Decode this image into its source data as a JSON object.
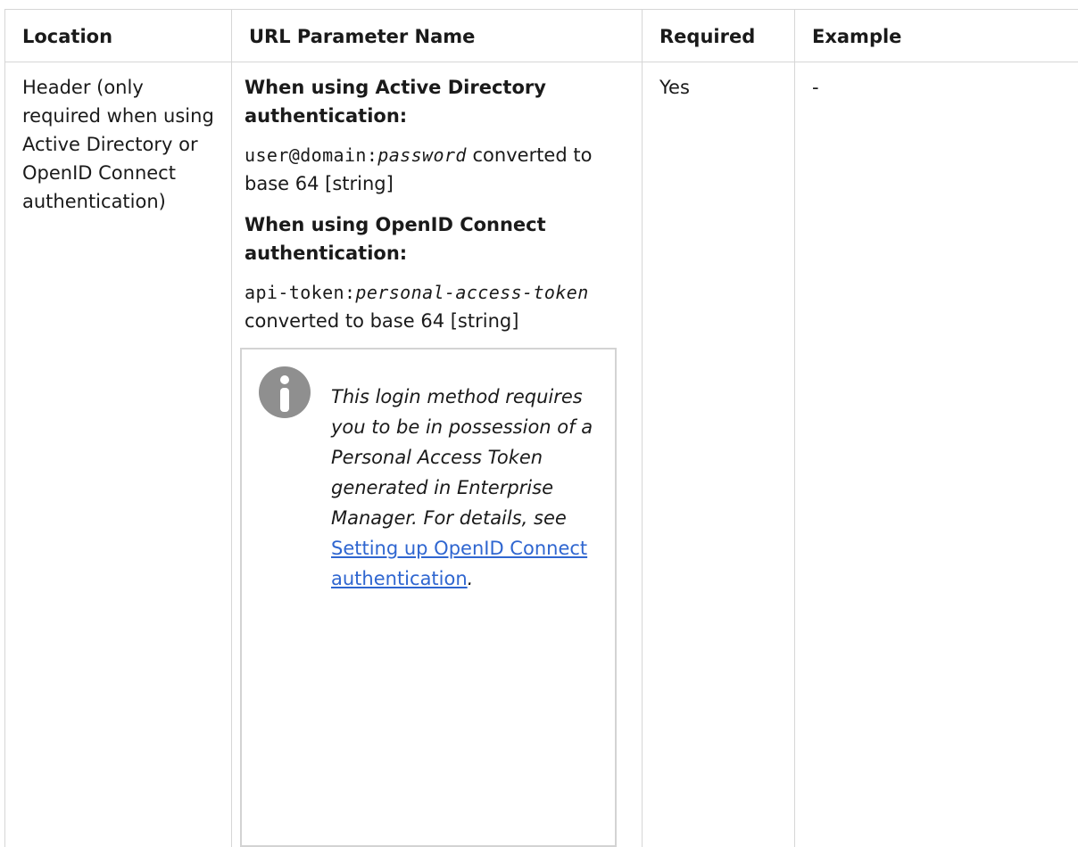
{
  "table": {
    "headers": {
      "location": "Location",
      "param": "URL Parameter Name",
      "required": "Required",
      "example": "Example"
    },
    "row": {
      "location": "Header (only required when using Active Directory or OpenID Connect authentication)",
      "ad_heading": "When using Active Directory authentication:",
      "ad_code_prefix": "user@domain:",
      "ad_code_var": "password",
      "ad_suffix": "converted to base 64 [string]",
      "oidc_heading": "When using OpenID Connect authentication:",
      "oidc_code_prefix": "api-token:",
      "oidc_code_var": "personal-access-token",
      "oidc_suffix": "converted to base 64 [string]",
      "note_text": "This login method requires you to be in possession of a Personal Access Token generated in Enterprise Manager. For details, see ",
      "note_link": "Setting up OpenID Connect authentication",
      "note_end": ".",
      "note_icon": "info-icon",
      "required": "Yes",
      "example": "-"
    }
  },
  "colors": {
    "border": "#d6d6d6",
    "link": "#2f66d0",
    "icon": "#8f8f8f"
  }
}
